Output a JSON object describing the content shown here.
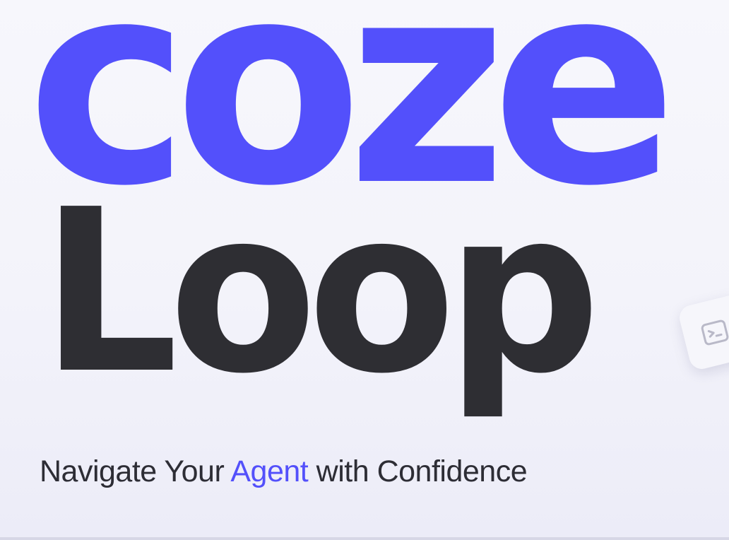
{
  "logo": {
    "line1": "coze",
    "line2": "Loop"
  },
  "tagline": {
    "before": "Navigate Your ",
    "highlight": "Agent",
    "after": " with Confidence"
  },
  "colors": {
    "brand_purple": "#5350fb",
    "dark_text": "#2e2e33",
    "tagline_text": "#2d2d35",
    "highlight": "#5350fb"
  },
  "badge": {
    "icon": "code-window-icon"
  }
}
